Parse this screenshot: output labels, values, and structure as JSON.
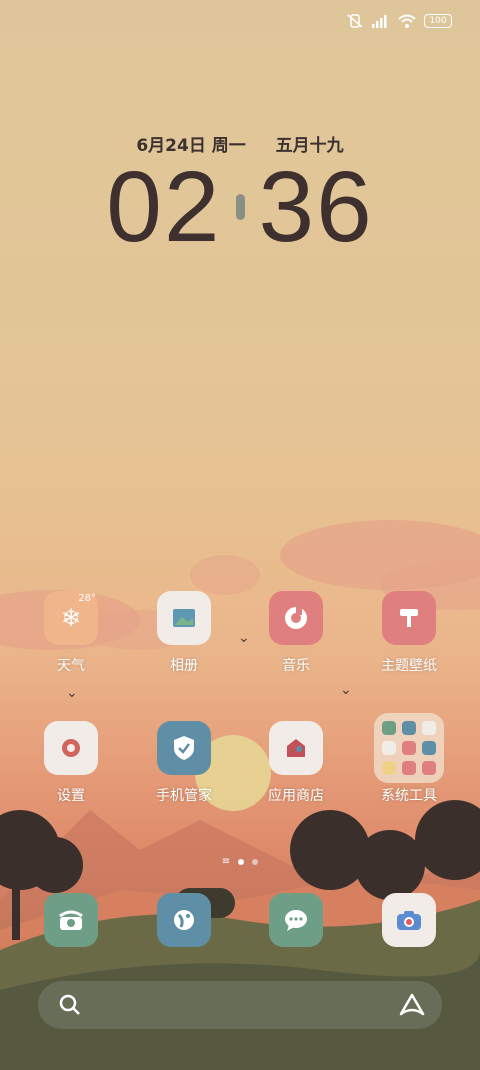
{
  "status": {
    "battery": "100"
  },
  "lockdate": {
    "date": "6月24日 周一",
    "lunar": "五月十九"
  },
  "clock": {
    "hours": "02",
    "minutes": "36"
  },
  "weather": {
    "temp": "28°"
  },
  "apps": {
    "weather": "天气",
    "photos": "相册",
    "music": "音乐",
    "themes": "主题壁纸",
    "settings": "设置",
    "phone_manager": "手机管家",
    "app_store": "应用商店",
    "system_tools": "系统工具"
  },
  "colors": {
    "weather_bg": "#f0b58a",
    "photos_bg": "#f1ece7",
    "music_bg": "#e07f7f",
    "themes_bg": "#e07f7f",
    "settings_bg": "#f1ece7",
    "phone_manager_bg": "#5e8fa6",
    "app_store_bg": "#f1ece7",
    "dock_phone_bg": "#6f9e86",
    "dock_contacts_bg": "#5e8fa6",
    "dock_messages_bg": "#6f9e86",
    "dock_camera_bg": "#f1ece7"
  },
  "pages": {
    "total": 2,
    "current": 1
  }
}
